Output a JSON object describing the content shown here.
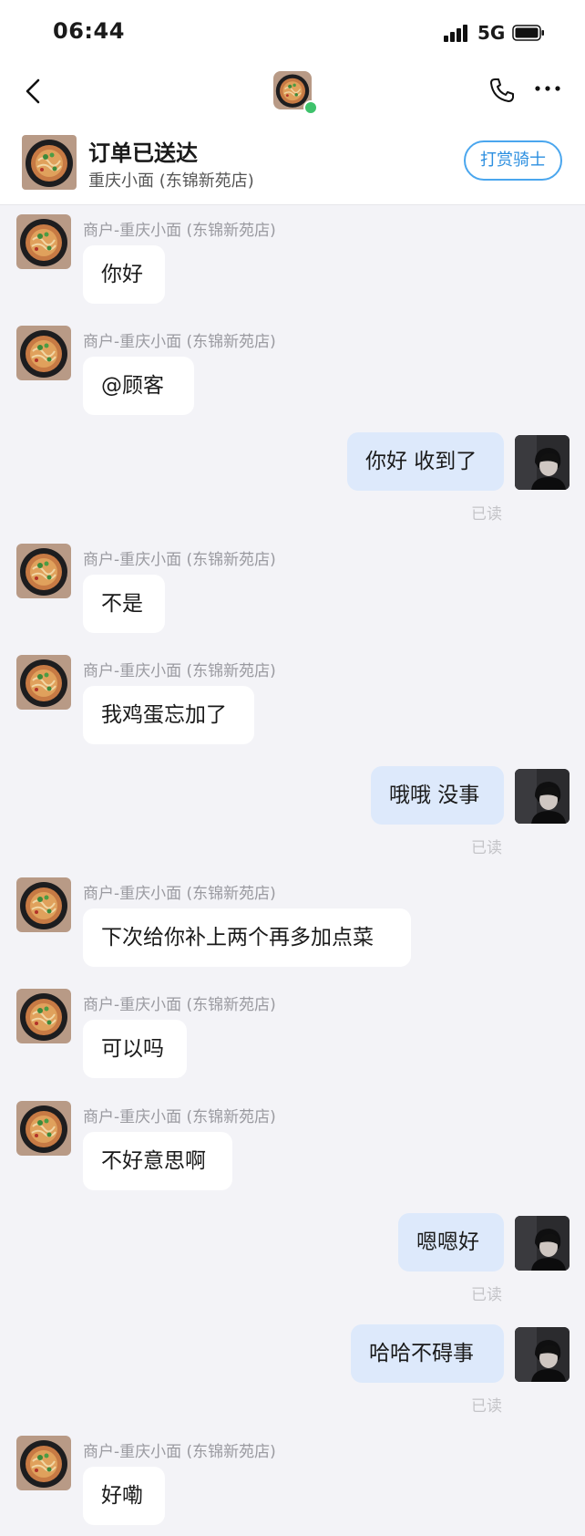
{
  "status_bar": {
    "time": "06:44",
    "network": "5G"
  },
  "order": {
    "title": "订单已送达",
    "shop": "重庆小面 (东锦新苑店)",
    "tip_button": "打赏骑士"
  },
  "icons": {
    "back": "chevron-left-icon",
    "phone": "phone-icon",
    "more": "more-dots-icon",
    "signal": "signal-bars-icon",
    "battery": "battery-icon"
  },
  "colors": {
    "accent": "#2c8fe0",
    "online": "#3ec26b",
    "outgoing_bubble": "#dde9fb",
    "background": "#f3f3f7"
  },
  "messages": [
    {
      "side": "in",
      "sender": "商户-重庆小面 (东锦新苑店)",
      "text": "你好"
    },
    {
      "side": "in",
      "sender": "商户-重庆小面 (东锦新苑店)",
      "text": "@顾客"
    },
    {
      "side": "out",
      "text": "你好 收到了",
      "status": "已读"
    },
    {
      "side": "in",
      "sender": "商户-重庆小面 (东锦新苑店)",
      "text": "不是"
    },
    {
      "side": "in",
      "sender": "商户-重庆小面 (东锦新苑店)",
      "text": "我鸡蛋忘加了"
    },
    {
      "side": "out",
      "text": "哦哦 没事",
      "status": "已读"
    },
    {
      "side": "in",
      "sender": "商户-重庆小面 (东锦新苑店)",
      "text": "下次给你补上两个再多加点菜"
    },
    {
      "side": "in",
      "sender": "商户-重庆小面 (东锦新苑店)",
      "text": "可以吗"
    },
    {
      "side": "in",
      "sender": "商户-重庆小面 (东锦新苑店)",
      "text": "不好意思啊"
    },
    {
      "side": "out",
      "text": "嗯嗯好",
      "status": "已读"
    },
    {
      "side": "out",
      "text": "哈哈不碍事",
      "status": "已读"
    },
    {
      "side": "in",
      "sender": "商户-重庆小面 (东锦新苑店)",
      "text": "好嘞"
    }
  ]
}
